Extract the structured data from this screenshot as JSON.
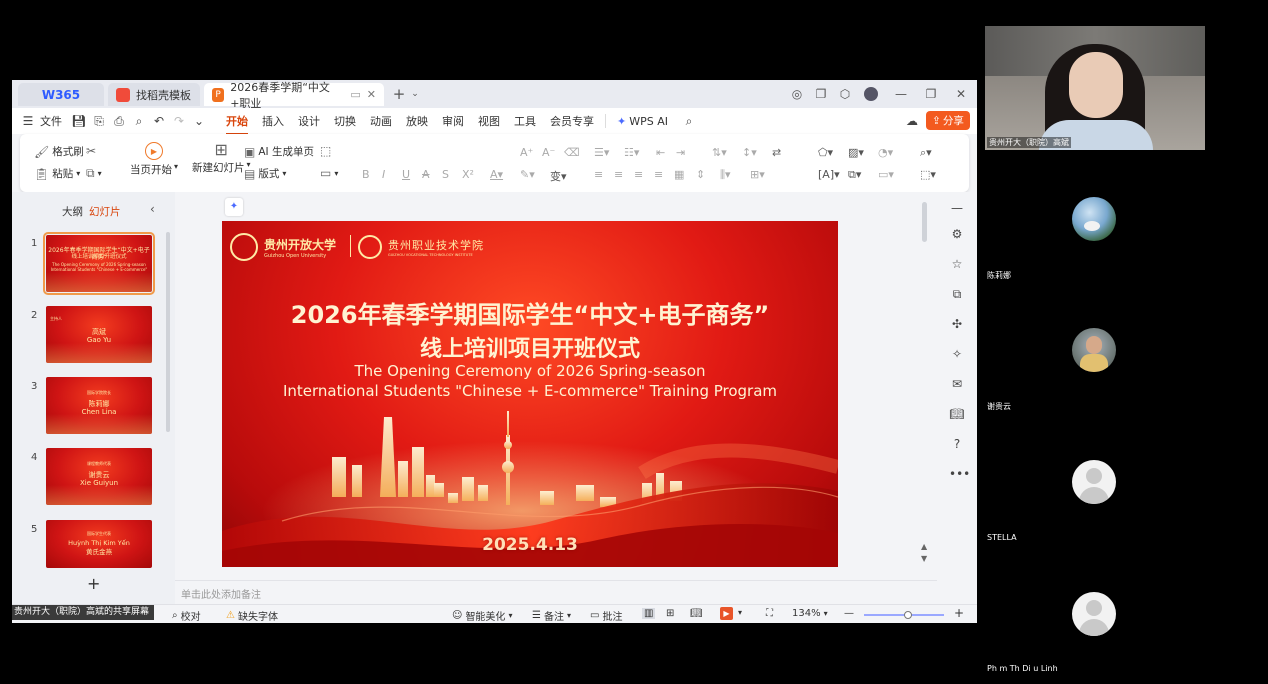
{
  "tabs": {
    "brand": "W365",
    "template_tab": "找稻壳模板",
    "doc_tab": "2026春季学期“中文+职业",
    "new_tab_icon": "plus-icon"
  },
  "menus": {
    "file": "文件",
    "items": [
      "开始",
      "插入",
      "设计",
      "切换",
      "动画",
      "放映",
      "审阅",
      "视图",
      "工具",
      "会员专享"
    ],
    "wps_ai": "WPS AI",
    "share": "分享"
  },
  "ribbon": {
    "format_painter": "格式刷",
    "paste": "粘贴",
    "play_from_current": "当页开始",
    "new_slide": "新建幻灯片",
    "ai_generate": "AI 生成单页",
    "layout": "版式"
  },
  "leftpanel": {
    "outline_tab": "大纲",
    "slides_tab": "幻灯片",
    "thumbs": [
      {
        "num": "1",
        "lines": [
          "2026年春季学期国际学生“中文+电子商务”",
          "线上培训项目开班仪式",
          "The Opening Ceremony of 2026 Spring-season",
          "International Students \"Chinese + E-commerce\""
        ]
      },
      {
        "num": "2",
        "lines": [
          "主持人",
          "高斌",
          "Gao Yu"
        ]
      },
      {
        "num": "3",
        "lines": [
          "国际学院院长",
          "陈莉娜",
          "Chen Lina"
        ]
      },
      {
        "num": "4",
        "lines": [
          "课程教师代表",
          "谢贵云",
          "Xie Guiyun"
        ]
      },
      {
        "num": "5",
        "lines": [
          "国际学生代表",
          "Huỳnh Thị Kim Yến",
          "黄氏金燕"
        ]
      }
    ]
  },
  "slide": {
    "logo_left_cn": "贵州开放大学",
    "logo_left_en": "Guizhou Open University",
    "logo_right_cn": "贵州职业技术学院",
    "logo_right_en": "GUIZHOU VOCATIONAL TECHNOLOGY INSTITUTE",
    "title_cn_1": "2026年春季学期国际学生“中文+电子商务”",
    "title_cn_2": "线上培训项目开班仪式",
    "title_en_1": "The Opening Ceremony of 2026 Spring-season",
    "title_en_2": "International Students \"Chinese + E-commerce\" Training Program",
    "date": "2025.4.13"
  },
  "notes_placeholder": "单击此处添加备注",
  "status": {
    "share_label": "贵州开大（职院）高斌的共享屏幕",
    "proofread": "校对",
    "missing_font": "缺失字体",
    "beautify": "智能美化",
    "notes": "备注",
    "comments": "批注",
    "zoom": "134%"
  },
  "participants": {
    "presenter": "贵州开大（职院）高斌",
    "p1": "陈莉娜",
    "p2": "谢贵云",
    "p3": "STELLA",
    "p4": "Ph m Th  Di u Linh"
  },
  "colors": {
    "accent": "#d9450c",
    "slide_red": "#e11a14",
    "gold": "#ffe9a6"
  }
}
